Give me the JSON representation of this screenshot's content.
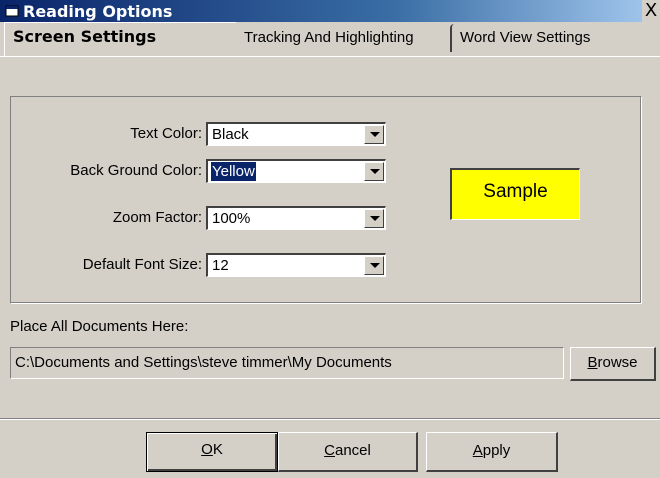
{
  "window": {
    "title": "Reading Options",
    "close_label": "X"
  },
  "tabs": [
    {
      "label": "Screen  Settings",
      "active": true
    },
    {
      "label": "Tracking And Highlighting",
      "active": false
    },
    {
      "label": "Word View Settings",
      "active": false
    }
  ],
  "settings": {
    "text_color": {
      "label": "Text Color:",
      "value": "Black"
    },
    "background_color": {
      "label": "Back Ground  Color:",
      "value": "Yellow"
    },
    "zoom_factor": {
      "label": "Zoom Factor:",
      "value": "100%"
    },
    "default_font_size": {
      "label": "Default Font Size:",
      "value": "12"
    }
  },
  "sample": {
    "label": "Sample",
    "background": "#ffff00"
  },
  "documents": {
    "label": "Place All Documents Here:",
    "path": "C:\\Documents and Settings\\steve timmer\\My Documents",
    "browse_label_underlined": "B",
    "browse_label_rest": "rowse"
  },
  "buttons": {
    "ok_u": "O",
    "ok_rest": "K",
    "cancel_u": "C",
    "cancel_rest": "ancel",
    "apply_u": "A",
    "apply_rest": "pply"
  }
}
